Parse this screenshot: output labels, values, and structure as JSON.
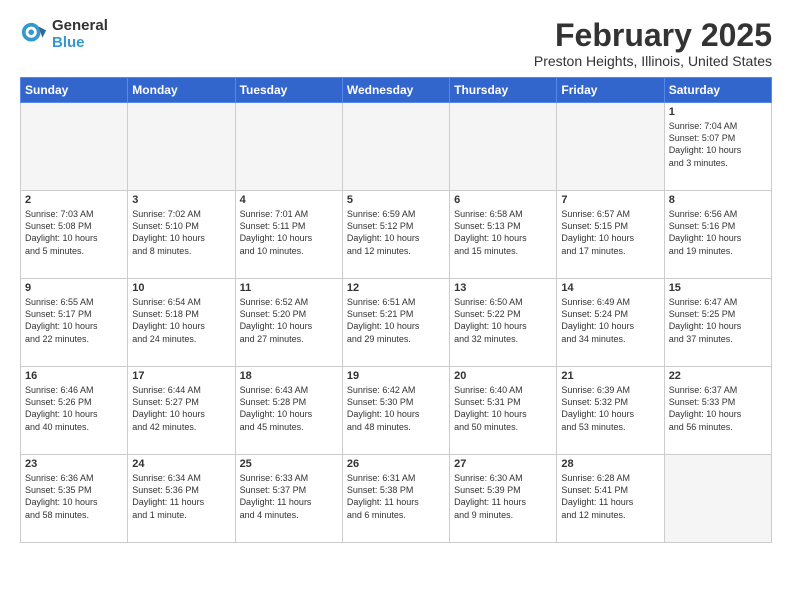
{
  "logo": {
    "general": "General",
    "blue": "Blue"
  },
  "title": "February 2025",
  "location": "Preston Heights, Illinois, United States",
  "headers": [
    "Sunday",
    "Monday",
    "Tuesday",
    "Wednesday",
    "Thursday",
    "Friday",
    "Saturday"
  ],
  "weeks": [
    [
      {
        "day": "",
        "info": ""
      },
      {
        "day": "",
        "info": ""
      },
      {
        "day": "",
        "info": ""
      },
      {
        "day": "",
        "info": ""
      },
      {
        "day": "",
        "info": ""
      },
      {
        "day": "",
        "info": ""
      },
      {
        "day": "1",
        "info": "Sunrise: 7:04 AM\nSunset: 5:07 PM\nDaylight: 10 hours\nand 3 minutes."
      }
    ],
    [
      {
        "day": "2",
        "info": "Sunrise: 7:03 AM\nSunset: 5:08 PM\nDaylight: 10 hours\nand 5 minutes."
      },
      {
        "day": "3",
        "info": "Sunrise: 7:02 AM\nSunset: 5:10 PM\nDaylight: 10 hours\nand 8 minutes."
      },
      {
        "day": "4",
        "info": "Sunrise: 7:01 AM\nSunset: 5:11 PM\nDaylight: 10 hours\nand 10 minutes."
      },
      {
        "day": "5",
        "info": "Sunrise: 6:59 AM\nSunset: 5:12 PM\nDaylight: 10 hours\nand 12 minutes."
      },
      {
        "day": "6",
        "info": "Sunrise: 6:58 AM\nSunset: 5:13 PM\nDaylight: 10 hours\nand 15 minutes."
      },
      {
        "day": "7",
        "info": "Sunrise: 6:57 AM\nSunset: 5:15 PM\nDaylight: 10 hours\nand 17 minutes."
      },
      {
        "day": "8",
        "info": "Sunrise: 6:56 AM\nSunset: 5:16 PM\nDaylight: 10 hours\nand 19 minutes."
      }
    ],
    [
      {
        "day": "9",
        "info": "Sunrise: 6:55 AM\nSunset: 5:17 PM\nDaylight: 10 hours\nand 22 minutes."
      },
      {
        "day": "10",
        "info": "Sunrise: 6:54 AM\nSunset: 5:18 PM\nDaylight: 10 hours\nand 24 minutes."
      },
      {
        "day": "11",
        "info": "Sunrise: 6:52 AM\nSunset: 5:20 PM\nDaylight: 10 hours\nand 27 minutes."
      },
      {
        "day": "12",
        "info": "Sunrise: 6:51 AM\nSunset: 5:21 PM\nDaylight: 10 hours\nand 29 minutes."
      },
      {
        "day": "13",
        "info": "Sunrise: 6:50 AM\nSunset: 5:22 PM\nDaylight: 10 hours\nand 32 minutes."
      },
      {
        "day": "14",
        "info": "Sunrise: 6:49 AM\nSunset: 5:24 PM\nDaylight: 10 hours\nand 34 minutes."
      },
      {
        "day": "15",
        "info": "Sunrise: 6:47 AM\nSunset: 5:25 PM\nDaylight: 10 hours\nand 37 minutes."
      }
    ],
    [
      {
        "day": "16",
        "info": "Sunrise: 6:46 AM\nSunset: 5:26 PM\nDaylight: 10 hours\nand 40 minutes."
      },
      {
        "day": "17",
        "info": "Sunrise: 6:44 AM\nSunset: 5:27 PM\nDaylight: 10 hours\nand 42 minutes."
      },
      {
        "day": "18",
        "info": "Sunrise: 6:43 AM\nSunset: 5:28 PM\nDaylight: 10 hours\nand 45 minutes."
      },
      {
        "day": "19",
        "info": "Sunrise: 6:42 AM\nSunset: 5:30 PM\nDaylight: 10 hours\nand 48 minutes."
      },
      {
        "day": "20",
        "info": "Sunrise: 6:40 AM\nSunset: 5:31 PM\nDaylight: 10 hours\nand 50 minutes."
      },
      {
        "day": "21",
        "info": "Sunrise: 6:39 AM\nSunset: 5:32 PM\nDaylight: 10 hours\nand 53 minutes."
      },
      {
        "day": "22",
        "info": "Sunrise: 6:37 AM\nSunset: 5:33 PM\nDaylight: 10 hours\nand 56 minutes."
      }
    ],
    [
      {
        "day": "23",
        "info": "Sunrise: 6:36 AM\nSunset: 5:35 PM\nDaylight: 10 hours\nand 58 minutes."
      },
      {
        "day": "24",
        "info": "Sunrise: 6:34 AM\nSunset: 5:36 PM\nDaylight: 11 hours\nand 1 minute."
      },
      {
        "day": "25",
        "info": "Sunrise: 6:33 AM\nSunset: 5:37 PM\nDaylight: 11 hours\nand 4 minutes."
      },
      {
        "day": "26",
        "info": "Sunrise: 6:31 AM\nSunset: 5:38 PM\nDaylight: 11 hours\nand 6 minutes."
      },
      {
        "day": "27",
        "info": "Sunrise: 6:30 AM\nSunset: 5:39 PM\nDaylight: 11 hours\nand 9 minutes."
      },
      {
        "day": "28",
        "info": "Sunrise: 6:28 AM\nSunset: 5:41 PM\nDaylight: 11 hours\nand 12 minutes."
      },
      {
        "day": "",
        "info": ""
      }
    ]
  ]
}
